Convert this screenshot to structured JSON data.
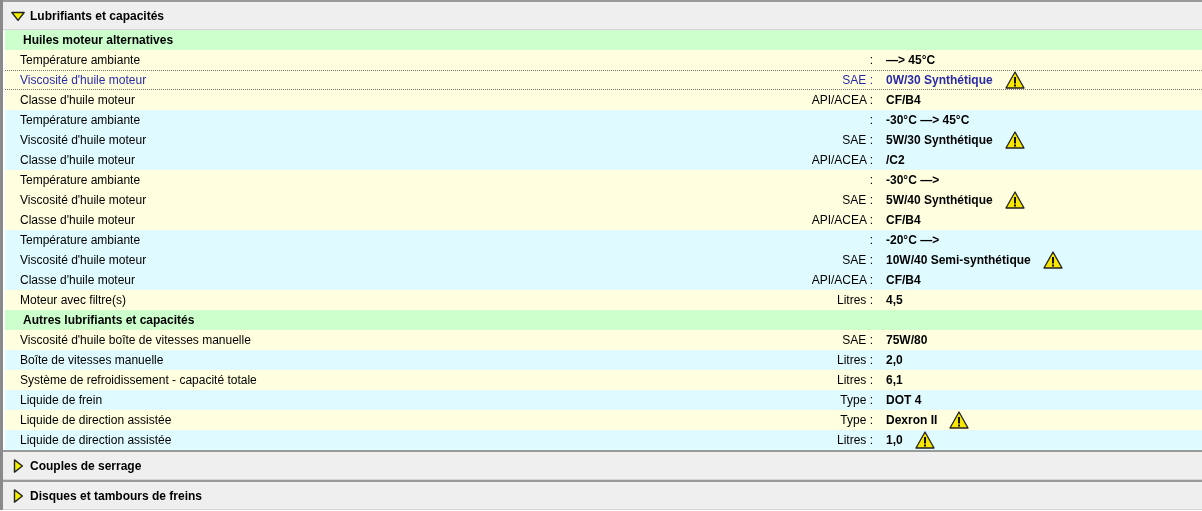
{
  "sections": [
    {
      "title": "Lubrifiants et capacités",
      "expanded": true,
      "groups": [
        {
          "title": "Huiles moteur alternatives",
          "rows": [
            {
              "label": "Température ambiante",
              "unit": ":",
              "value": "—> 45°C",
              "shaded": false,
              "selected": false,
              "warning": false
            },
            {
              "label": "Viscosité d'huile moteur",
              "unit": "SAE :",
              "value": "0W/30 Synthétique",
              "shaded": false,
              "selected": true,
              "warning": true
            },
            {
              "label": "Classe d'huile moteur",
              "unit": "API/ACEA :",
              "value": "CF/B4",
              "shaded": false,
              "selected": false,
              "warning": false
            },
            {
              "label": "Température ambiante",
              "unit": ":",
              "value": "-30°C —> 45°C",
              "shaded": true,
              "selected": false,
              "warning": false
            },
            {
              "label": "Viscosité d'huile moteur",
              "unit": "SAE :",
              "value": "5W/30 Synthétique",
              "shaded": true,
              "selected": false,
              "warning": true
            },
            {
              "label": "Classe d'huile moteur",
              "unit": "API/ACEA :",
              "value": "/C2",
              "shaded": true,
              "selected": false,
              "warning": false
            },
            {
              "label": "Température ambiante",
              "unit": ":",
              "value": "-30°C —>",
              "shaded": false,
              "selected": false,
              "warning": false
            },
            {
              "label": "Viscosité d'huile moteur",
              "unit": "SAE :",
              "value": "5W/40 Synthétique",
              "shaded": false,
              "selected": false,
              "warning": true
            },
            {
              "label": "Classe d'huile moteur",
              "unit": "API/ACEA :",
              "value": "CF/B4",
              "shaded": false,
              "selected": false,
              "warning": false
            },
            {
              "label": "Température ambiante",
              "unit": ":",
              "value": "-20°C —>",
              "shaded": true,
              "selected": false,
              "warning": false
            },
            {
              "label": "Viscosité d'huile moteur",
              "unit": "SAE :",
              "value": "10W/40 Semi-synthétique",
              "shaded": true,
              "selected": false,
              "warning": true
            },
            {
              "label": "Classe d'huile moteur",
              "unit": "API/ACEA :",
              "value": "CF/B4",
              "shaded": true,
              "selected": false,
              "warning": false
            },
            {
              "label": "Moteur avec filtre(s)",
              "unit": "Litres :",
              "value": "4,5",
              "shaded": false,
              "selected": false,
              "warning": false
            }
          ]
        },
        {
          "title": "Autres lubrifiants et capacités",
          "rows": [
            {
              "label": "Viscosité d'huile boîte de vitesses manuelle",
              "unit": "SAE :",
              "value": "75W/80",
              "shaded": false,
              "selected": false,
              "warning": false
            },
            {
              "label": "Boîte de vitesses manuelle",
              "unit": "Litres :",
              "value": "2,0",
              "shaded": true,
              "selected": false,
              "warning": false
            },
            {
              "label": "Système de refroidissement - capacité totale",
              "unit": "Litres :",
              "value": "6,1",
              "shaded": false,
              "selected": false,
              "warning": false
            },
            {
              "label": "Liquide de frein",
              "unit": "Type :",
              "value": "DOT 4",
              "shaded": true,
              "selected": false,
              "warning": false
            },
            {
              "label": "Liquide de direction assistée",
              "unit": "Type :",
              "value": "Dexron II",
              "shaded": false,
              "selected": false,
              "warning": true
            },
            {
              "label": "Liquide de direction assistée",
              "unit": "Litres :",
              "value": "1,0",
              "shaded": true,
              "selected": false,
              "warning": true
            }
          ]
        }
      ]
    },
    {
      "title": "Couples de serrage",
      "expanded": false
    },
    {
      "title": "Disques et tambours de freins",
      "expanded": false
    }
  ]
}
